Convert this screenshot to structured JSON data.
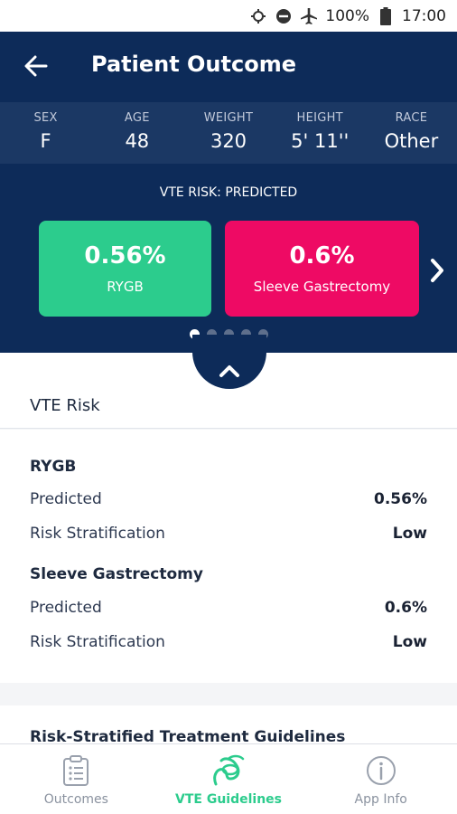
{
  "status_bar": {
    "battery": "100%",
    "time": "17:00",
    "icons": [
      "location-icon",
      "do-not-disturb-icon",
      "airplane-icon",
      "battery-icon"
    ]
  },
  "header": {
    "title": "Patient Outcome",
    "back_icon": "arrow-left-icon"
  },
  "demographics": [
    {
      "label": "SEX",
      "value": "F"
    },
    {
      "label": "AGE",
      "value": "48"
    },
    {
      "label": "WEIGHT",
      "value": "320"
    },
    {
      "label": "HEIGHT",
      "value": "5' 11''"
    },
    {
      "label": "RACE",
      "value": "Other"
    }
  ],
  "risk_carousel": {
    "caption": "VTE RISK: PREDICTED",
    "cards": [
      {
        "value": "0.56%",
        "label": "RYGB",
        "color": "#2ccc8d"
      },
      {
        "value": "0.6%",
        "label": "Sleeve Gastrectomy",
        "color": "#ee0a64"
      }
    ],
    "page_count": 5,
    "active_page": 1
  },
  "vte_section": {
    "title": "VTE Risk",
    "groups": [
      {
        "name": "RYGB",
        "rows": [
          {
            "label": "Predicted",
            "value": "0.56%"
          },
          {
            "label": "Risk Stratification",
            "value": "Low"
          }
        ]
      },
      {
        "name": "Sleeve Gastrectomy",
        "rows": [
          {
            "label": "Predicted",
            "value": "0.6%"
          },
          {
            "label": "Risk Stratification",
            "value": "Low"
          }
        ]
      }
    ]
  },
  "guidelines": {
    "title": "Risk-Stratified Treatment Guidelines"
  },
  "tabbar": {
    "tabs": [
      {
        "label": "Outcomes",
        "icon": "clipboard-icon",
        "active": false
      },
      {
        "label": "VTE Guidelines",
        "icon": "vte-guidelines-icon",
        "active": true
      },
      {
        "label": "App Info",
        "icon": "info-icon",
        "active": false
      }
    ]
  },
  "colors": {
    "navy": "#0d2b59",
    "navy_band": "#1b3864",
    "green": "#2ccc8d",
    "pink": "#ee0a64"
  }
}
